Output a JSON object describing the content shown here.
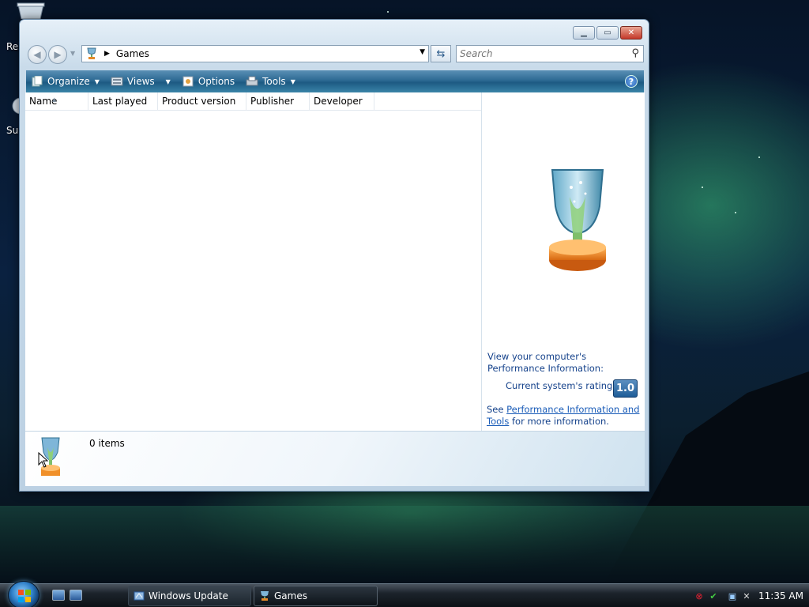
{
  "desktop": {
    "icons": [
      {
        "label": "Re"
      },
      {
        "label": "Su"
      }
    ]
  },
  "window": {
    "title_buttons": {
      "minimize": "minimize",
      "maximize": "maximize",
      "close": "close"
    },
    "address": {
      "location": "Games"
    },
    "search": {
      "placeholder": "Search"
    },
    "toolbar": {
      "organize": "Organize",
      "views": "Views",
      "options": "Options",
      "tools": "Tools"
    },
    "columns": [
      "Name",
      "Last played",
      "Product version",
      "Publisher",
      "Developer"
    ],
    "details": {
      "perf_link": "View your computer's Performance Information:",
      "rating_label": "Current system's rating:",
      "rating_value": "1.0",
      "see_prefix": "See ",
      "see_link": "Performance Information and Tools",
      "see_suffix": " for more information."
    },
    "status": {
      "count": "0 items"
    }
  },
  "taskbar": {
    "tasks": [
      {
        "label": "Windows Update"
      },
      {
        "label": "Games"
      }
    ],
    "clock": "11:35 AM"
  },
  "colors": {
    "toolbar": "#2d6a93",
    "link": "#1a5cb8",
    "rating_badge": "#1f5d98"
  }
}
